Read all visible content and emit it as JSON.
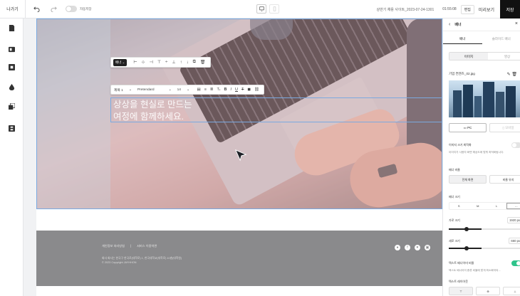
{
  "topbar": {
    "exit_label": "나가기",
    "undo_icon": "undo-icon",
    "redo_icon": "redo-icon",
    "autosave_label": "자동저장",
    "site_name": "상반기 채용 사이트_2023-07-24-1301",
    "time": "01:55:08",
    "edit_label": "편집",
    "preview_label": "미리보기",
    "save_label": "저장"
  },
  "leftbar": {
    "icons": [
      "page-icon",
      "section-icon",
      "block-icon",
      "theme-icon",
      "layer-icon",
      "template-icon"
    ]
  },
  "element_toolbar": {
    "tag": "배너 ⌄",
    "icons": [
      "align-left-icon",
      "align-center-icon",
      "align-right-icon",
      "align-top-icon",
      "align-middle-icon",
      "align-bottom-icon",
      "move-up-icon",
      "move-down-icon",
      "copy-icon",
      "delete-icon"
    ]
  },
  "text_toolbar": {
    "style": "제목 1",
    "font": "Pretendard",
    "size": "14",
    "icons": [
      "align-left-icon",
      "align-center-icon",
      "align-right-icon",
      "text-size-icon",
      "bold-icon",
      "italic-icon",
      "underline-icon",
      "strikethrough-icon",
      "color-icon",
      "link-icon"
    ]
  },
  "banner": {
    "line1": "상상을 현실로 만드는",
    "line2": "여정에 함께하세요."
  },
  "footer": {
    "links": [
      "개인정보 처리방침",
      "|",
      "서비스 이용약관"
    ],
    "info1": "회사 회사는 한국구 한국로(대학로) 1, 한국대학교(대학로) 10층(대학원)",
    "info2": "© 2023 Copyright JAYHHON",
    "social": [
      "●",
      "f",
      "♥",
      "▣"
    ]
  },
  "panel": {
    "title": "배너",
    "tabs": [
      "배너",
      "슬라이드 배너"
    ],
    "media_tabs": [
      "이미지",
      "영상"
    ],
    "file_name": "기업 컨텐츠_02.jpg",
    "device_tabs": [
      "PC",
      "모바일"
    ],
    "image_fit_label": "이미지 크기 최적화",
    "image_fit_desc": "이미지가 사용자 화면 해상도에 맞춰 최적화됩니다.",
    "ratio_label": "배너 비율",
    "ratio_options": [
      "전체 화면",
      "비율 유지"
    ],
    "size_label": "배너 크기",
    "size_options": [
      "S",
      "M",
      "L",
      "···"
    ],
    "width_label": "가로 크기",
    "width_value": "1920 px",
    "height_label": "세로 크기",
    "height_value": "660 px",
    "shadow_label": "텍스트 배너이미 비율",
    "shadow_desc": "텍스트 배너이미 종류 비율에 맞게 최소화하되...",
    "align_label": "텍스트 레이아웃",
    "align_options": [
      "⊤",
      "⊕",
      "⊥"
    ]
  }
}
